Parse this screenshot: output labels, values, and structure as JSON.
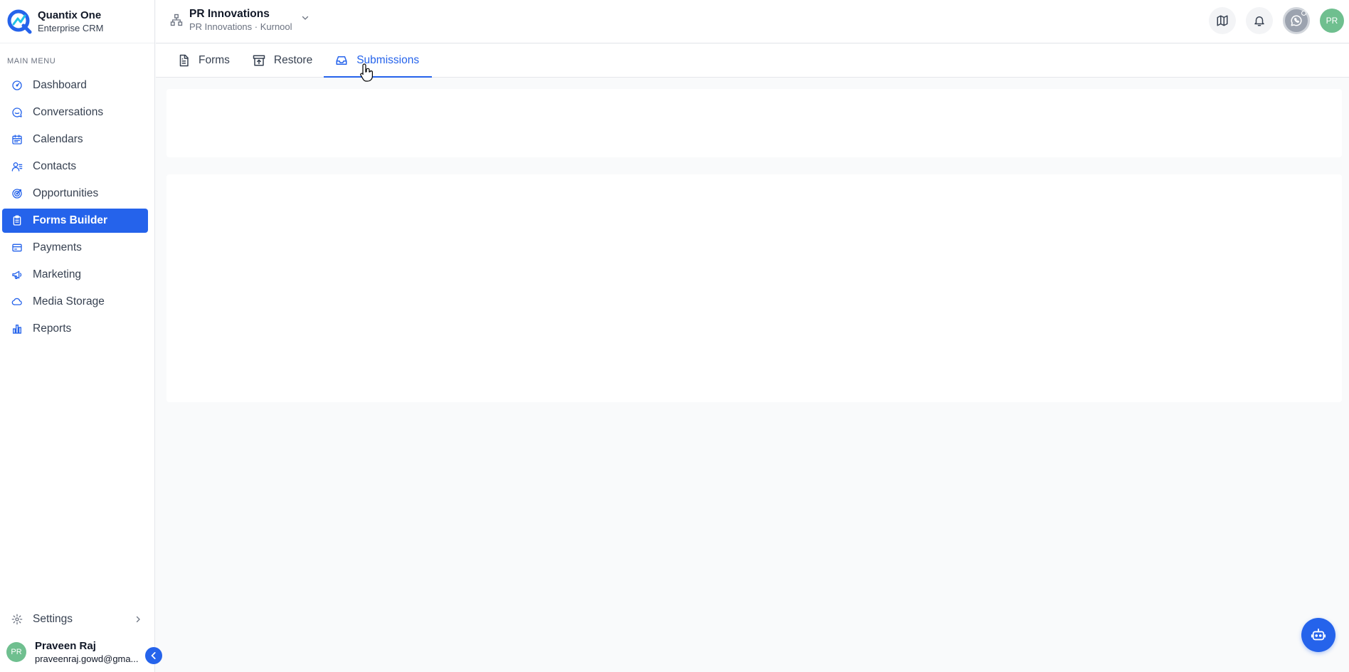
{
  "brand": {
    "name": "Quantix One",
    "subtitle": "Enterprise CRM"
  },
  "sidebar": {
    "section_label": "MAIN MENU",
    "items": [
      {
        "label": "Dashboard",
        "icon": "gauge-icon"
      },
      {
        "label": "Conversations",
        "icon": "chat-icon"
      },
      {
        "label": "Calendars",
        "icon": "calendar-icon"
      },
      {
        "label": "Contacts",
        "icon": "contacts-icon"
      },
      {
        "label": "Opportunities",
        "icon": "target-icon"
      },
      {
        "label": "Forms Builder",
        "icon": "clipboard-icon",
        "active": true
      },
      {
        "label": "Payments",
        "icon": "credit-card-icon"
      },
      {
        "label": "Marketing",
        "icon": "megaphone-icon"
      },
      {
        "label": "Media Storage",
        "icon": "cloud-icon"
      },
      {
        "label": "Reports",
        "icon": "bar-chart-icon"
      }
    ],
    "settings_label": "Settings",
    "user": {
      "initials": "PR",
      "name": "Praveen Raj",
      "email": "praveenraj.gowd@gma..."
    }
  },
  "header": {
    "org_name": "PR Innovations",
    "org_sub": "PR Innovations · Kurnool",
    "avatar_initials": "PR"
  },
  "tabs": [
    {
      "label": "Forms",
      "icon": "document-icon"
    },
    {
      "label": "Restore",
      "icon": "archive-restore-icon"
    },
    {
      "label": "Submissions",
      "icon": "inbox-icon",
      "active": true
    }
  ],
  "colors": {
    "accent": "#2563eb",
    "avatar": "#6fbf8f",
    "background": "#f9fafb"
  }
}
